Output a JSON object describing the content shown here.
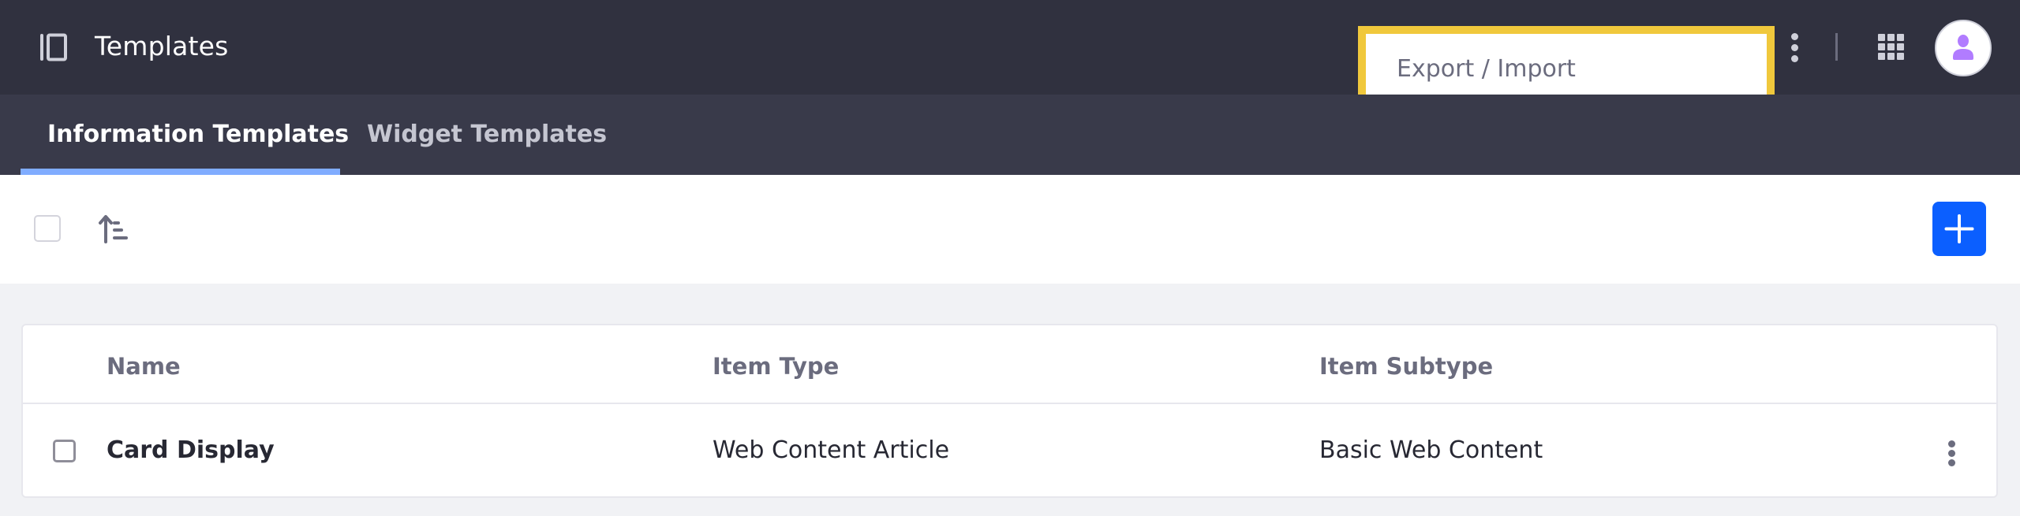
{
  "header": {
    "title": "Templates",
    "icons": {
      "sidebar_toggle": "sidebar-panel-icon",
      "options": "vertical-ellipsis-icon",
      "apps": "apps-grid-icon",
      "avatar": "user-icon"
    },
    "dropdown_menu": {
      "items": [
        {
          "label": "Export / Import"
        }
      ]
    }
  },
  "tabs": [
    {
      "label": "Information Templates",
      "active": true
    },
    {
      "label": "Widget Templates",
      "active": false
    }
  ],
  "toolbar": {
    "select_all_checked": false,
    "sort_icon": "order-ascending-icon",
    "add_icon": "plus-icon"
  },
  "table": {
    "columns": [
      "Name",
      "Item Type",
      "Item Subtype"
    ],
    "rows": [
      {
        "name": "Card Display",
        "item_type": "Web Content Article",
        "item_subtype": "Basic Web Content",
        "checked": false
      }
    ]
  },
  "colors": {
    "header_bg": "#30313f",
    "tab_bar_bg": "#393a4a",
    "tab_active_indicator": "#80acff",
    "highlight_border": "#f0c83c",
    "primary_button": "#0b5fff",
    "avatar_icon": "#b17cff",
    "page_bg": "#f1f2f5"
  }
}
